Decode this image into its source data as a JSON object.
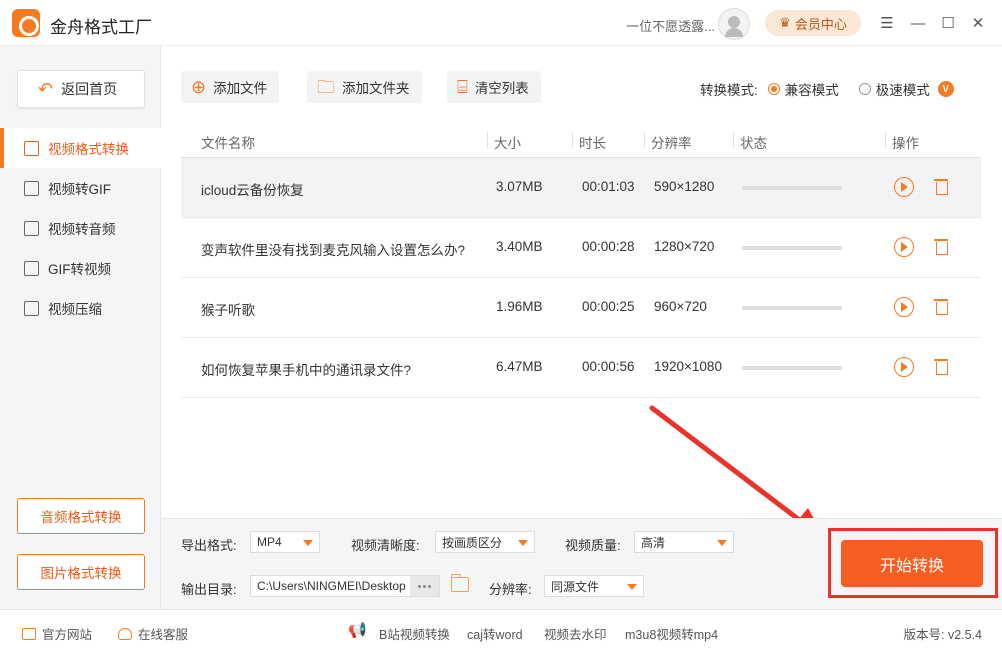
{
  "titlebar": {
    "app_title": "金舟格式工厂",
    "user_name": "一位不愿透露...",
    "vip_label": "会员中心"
  },
  "sidebar": {
    "back_label": "返回首页",
    "items": [
      {
        "label": "视频格式转换",
        "active": true
      },
      {
        "label": "视频转GIF"
      },
      {
        "label": "视频转音频"
      },
      {
        "label": "GIF转视频"
      },
      {
        "label": "视频压缩"
      }
    ],
    "audio_btn": "音频格式转换",
    "image_btn": "图片格式转换"
  },
  "toolbar": {
    "add_file": "添加文件",
    "add_folder": "添加文件夹",
    "clear_list": "清空列表",
    "mode_label": "转换模式:",
    "mode_compat": "兼容模式",
    "mode_fast": "极速模式",
    "v_badge": "V"
  },
  "table": {
    "headers": {
      "name": "文件名称",
      "size": "大小",
      "duration": "时长",
      "resolution": "分辨率",
      "status": "状态",
      "action": "操作"
    },
    "rows": [
      {
        "name": "icloud云备份恢复",
        "size": "3.07MB",
        "duration": "00:01:03",
        "resolution": "590×1280"
      },
      {
        "name": "变声软件里没有找到麦克风输入设置怎么办?",
        "size": "3.40MB",
        "duration": "00:00:28",
        "resolution": "1280×720"
      },
      {
        "name": "猴子听歌",
        "size": "1.96MB",
        "duration": "00:00:25",
        "resolution": "960×720"
      },
      {
        "name": "如何恢复苹果手机中的通讯录文件?",
        "size": "6.47MB",
        "duration": "00:00:56",
        "resolution": "1920×1080"
      }
    ]
  },
  "settings": {
    "format_label": "导出格式:",
    "format_value": "MP4",
    "clarity_label": "视频清晰度:",
    "clarity_value": "按画质区分",
    "quality_label": "视频质量:",
    "quality_value": "高清",
    "output_label": "输出目录:",
    "output_path": "C:\\Users\\NINGMEI\\Desktop",
    "resolution_label": "分辨率:",
    "resolution_value": "同源文件",
    "start_label": "开始转换"
  },
  "footer": {
    "website": "官方网站",
    "support": "在线客服",
    "links": [
      "B站视频转换",
      "caj转word",
      "视频去水印",
      "m3u8视频转mp4"
    ],
    "version": "版本号: v2.5.4"
  },
  "colors": {
    "accent": "#f57b22",
    "start": "#f55d22",
    "highlight": "#e8342a"
  }
}
